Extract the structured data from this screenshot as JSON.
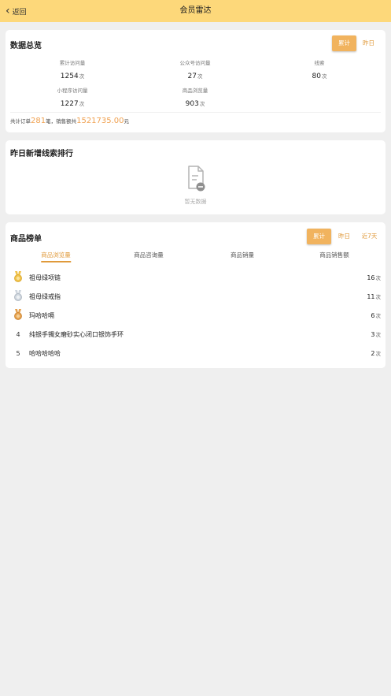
{
  "header": {
    "back_label": "返回",
    "title": "会员雷达"
  },
  "overview": {
    "title": "数据总览",
    "tabs": [
      "累计",
      "昨日"
    ],
    "stats": [
      {
        "label": "累计访问量",
        "value": "1254",
        "unit": "次"
      },
      {
        "label": "公众号访问量",
        "value": "27",
        "unit": "次"
      },
      {
        "label": "线索",
        "value": "80",
        "unit": "次"
      },
      {
        "label": "小程序访问量",
        "value": "1227",
        "unit": "次"
      },
      {
        "label": "商品浏览量",
        "value": "903",
        "unit": "次"
      }
    ],
    "totals": {
      "prefix": "共计订单",
      "orders": "281",
      "middle": "笔，销售额共",
      "sales": "1521735.00",
      "suffix": "元"
    }
  },
  "leads": {
    "title": "昨日新增线索排行",
    "empty_text": "暂无数据"
  },
  "products": {
    "title": "商品榜单",
    "tabs": [
      "累计",
      "昨日",
      "近7天"
    ],
    "sub_tabs": [
      "商品浏览量",
      "商品咨询量",
      "商品销量",
      "商品销售额"
    ],
    "rows": [
      {
        "rank": "1",
        "name": "祖母绿项链",
        "count": "16",
        "unit": "次"
      },
      {
        "rank": "2",
        "name": "祖母绿戒指",
        "count": "11",
        "unit": "次"
      },
      {
        "rank": "3",
        "name": "玛哈哈嗝",
        "count": "6",
        "unit": "次"
      },
      {
        "rank": "4",
        "name": "纯银手镯女磨砂实心闭口银饰手环",
        "count": "3",
        "unit": "次"
      },
      {
        "rank": "5",
        "name": "哈哈哈哈哈",
        "count": "2",
        "unit": "次"
      }
    ]
  },
  "colors": {
    "header": "#fdd87a",
    "accent": "#e09a3b",
    "gold": "#f0c24a",
    "silver": "#cfd6de",
    "bronze": "#e6a24f"
  }
}
